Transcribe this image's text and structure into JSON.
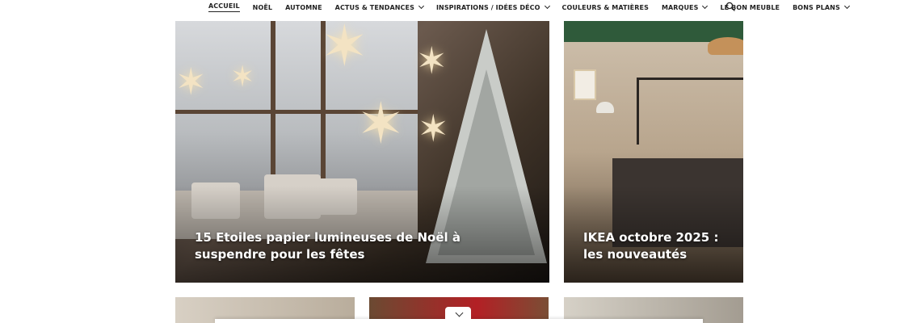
{
  "nav": {
    "items": [
      {
        "label": "ACCUEIL",
        "active": true,
        "dropdown": false
      },
      {
        "label": "NOËL",
        "active": false,
        "dropdown": false
      },
      {
        "label": "AUTOMNE",
        "active": false,
        "dropdown": false
      },
      {
        "label": "ACTUS & TENDANCES",
        "active": false,
        "dropdown": true
      },
      {
        "label": "INSPIRATIONS / IDÉES DÉCO",
        "active": false,
        "dropdown": true
      },
      {
        "label": "COULEURS & MATIÈRES",
        "active": false,
        "dropdown": false
      },
      {
        "label": "MARQUES",
        "active": false,
        "dropdown": true
      },
      {
        "label": "LE BON MEUBLE",
        "active": false,
        "dropdown": false
      },
      {
        "label": "BONS PLANS",
        "active": false,
        "dropdown": true
      }
    ],
    "search_icon": "search-icon"
  },
  "featured": {
    "main": {
      "title": "15 Etoiles papier lumineuses de Noël à suspendre pour les fêtes"
    },
    "side": {
      "title": "IKEA octobre 2025 : les nouveautés"
    }
  },
  "footer": {
    "expand_icon": "chevron-down-icon"
  }
}
